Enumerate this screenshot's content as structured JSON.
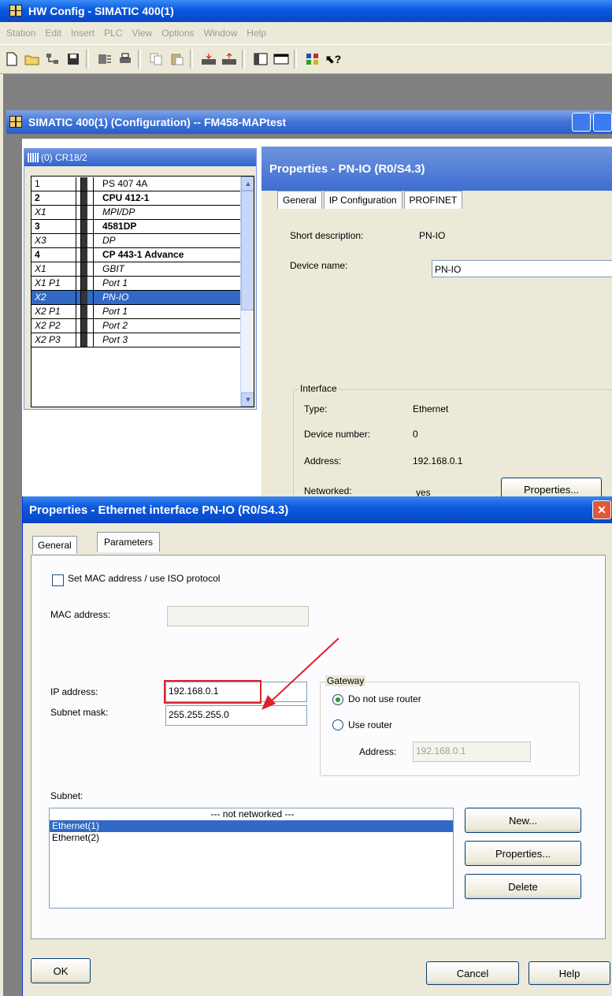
{
  "app": {
    "title": "HW Config - SIMATIC 400(1)"
  },
  "menu": [
    "Station",
    "Edit",
    "Insert",
    "PLC",
    "View",
    "Options",
    "Window",
    "Help"
  ],
  "toolbar": {
    "icons": [
      "new-icon",
      "open-icon",
      "network-icon",
      "save-icon",
      "compile-icon",
      "print-icon",
      "copy-icon",
      "paste-icon",
      "download-icon",
      "upload-icon",
      "catalog-icon",
      "window-icon",
      "netpro-icon",
      "help-icon"
    ]
  },
  "config_window": {
    "title": "SIMATIC 400(1) (Configuration) -- FM458-MAPtest"
  },
  "rack": {
    "title": "(0) CR18/2",
    "rows": [
      {
        "slot": "1",
        "module": "PS 407 4A",
        "style": "normal"
      },
      {
        "slot": "2",
        "module": "CPU 412-1",
        "style": "bold"
      },
      {
        "slot": "X1",
        "module": "MPI/DP",
        "style": "italic"
      },
      {
        "slot": "3",
        "module": "4581DP",
        "style": "bold"
      },
      {
        "slot": "X3",
        "module": "DP",
        "style": "italic"
      },
      {
        "slot": "4",
        "module": "CP 443-1 Advance",
        "style": "bold"
      },
      {
        "slot": "X1",
        "module": "GBIT",
        "style": "italic"
      },
      {
        "slot": "X1 P1",
        "module": "Port 1",
        "style": "italic"
      },
      {
        "slot": "X2",
        "module": "PN-IO",
        "style": "selected"
      },
      {
        "slot": "X2 P1",
        "module": "Port 1",
        "style": "italic"
      },
      {
        "slot": "X2 P2",
        "module": "Port 2",
        "style": "italic"
      },
      {
        "slot": "X2 P3",
        "module": "Port 3",
        "style": "italic"
      }
    ]
  },
  "pnio_props": {
    "title": "Properties - PN-IO (R0/S4.3)",
    "tabs": [
      "General",
      "IP Configuration",
      "PROFINET"
    ],
    "short_desc_label": "Short description:",
    "short_desc_value": "PN-IO",
    "device_name_label": "Device name:",
    "device_name_value": "PN-IO",
    "interface_group": "Interface",
    "type_label": "Type:",
    "type_value": "Ethernet",
    "devnum_label": "Device number:",
    "devnum_value": "0",
    "address_label": "Address:",
    "address_value": "192.168.0.1",
    "networked_label": "Networked:",
    "networked_value": "yes",
    "properties_button": "Properties..."
  },
  "eth_dialog": {
    "title": "Properties - Ethernet interface  PN-IO (R0/S4.3)",
    "close_label": "✕",
    "tabs": [
      "General",
      "Parameters"
    ],
    "mac_checkbox_label": "Set MAC address / use ISO protocol",
    "mac_label": "MAC address:",
    "mac_value": "",
    "ip_label": "IP address:",
    "ip_value": "192.168.0.1",
    "subnet_label": "Subnet mask:",
    "subnet_value": "255.255.255.0",
    "gateway_group": "Gateway",
    "no_router_label": "Do not use router",
    "use_router_label": "Use router",
    "router_addr_label": "Address:",
    "router_addr_value": "192.168.0.1",
    "subnet_list_label": "Subnet:",
    "subnets": [
      "--- not networked ---",
      "Ethernet(1)",
      "Ethernet(2)"
    ],
    "selected_subnet": "Ethernet(1)",
    "new_button": "New...",
    "properties_button": "Properties...",
    "delete_button": "Delete",
    "ok_button": "OK",
    "cancel_button": "Cancel",
    "help_button": "Help"
  },
  "colors": {
    "title_blue": "#0a58e0",
    "selection": "#316ac5",
    "highlight_red": "#e0202a"
  }
}
